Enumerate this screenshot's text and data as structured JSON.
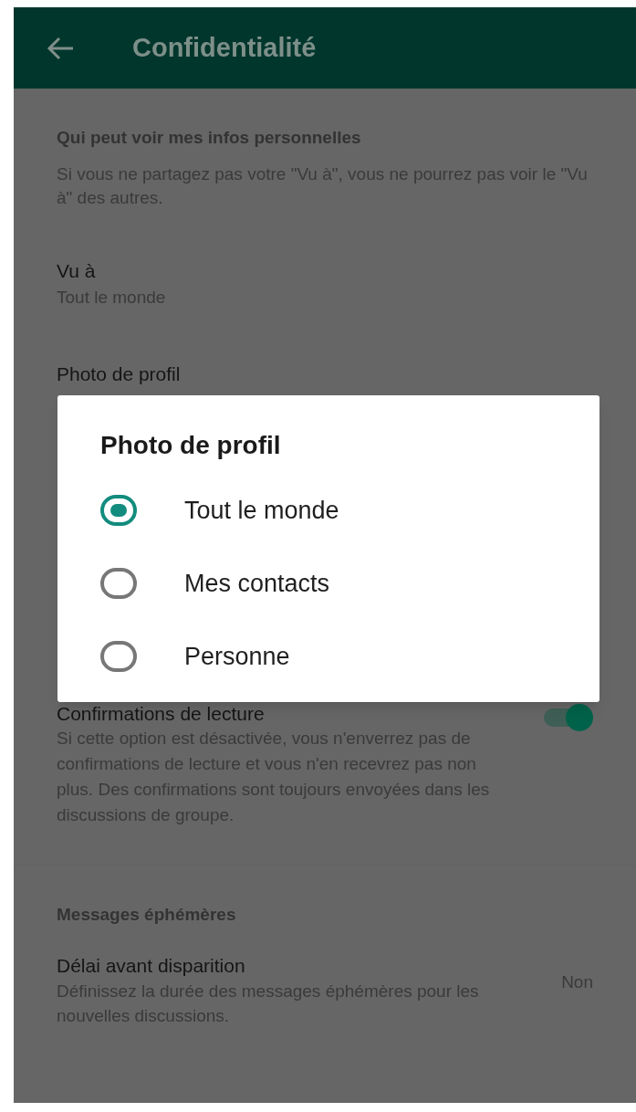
{
  "header": {
    "title": "Confidentialité"
  },
  "sections": [
    {
      "title": "Qui peut voir mes infos personnelles",
      "description": "Si vous ne partagez pas votre \"Vu à\", vous ne pourrez pas voir le \"Vu à\" des autres.",
      "items": [
        {
          "kind": "value",
          "label": "Vu à",
          "value": "Tout le monde"
        },
        {
          "kind": "plain",
          "label": "Photo de profil"
        },
        {
          "kind": "toggle",
          "label": "Confirmations de lecture",
          "description": "Si cette option est désactivée, vous n'enverrez pas de confirmations de lecture et vous n'en recevrez pas non plus. Des confirmations sont toujours envoyées dans les discussions de groupe.",
          "on": true
        }
      ]
    },
    {
      "title": "Messages éphémères",
      "items": [
        {
          "kind": "side-value",
          "label": "Délai avant disparition",
          "description": "Définissez la durée des messages éphémères pour les nouvelles discussions.",
          "value": "Non"
        }
      ]
    }
  ],
  "dialog": {
    "title": "Photo de profil",
    "options": [
      {
        "label": "Tout le monde",
        "selected": true
      },
      {
        "label": "Mes contacts",
        "selected": false
      },
      {
        "label": "Personne",
        "selected": false
      }
    ]
  }
}
